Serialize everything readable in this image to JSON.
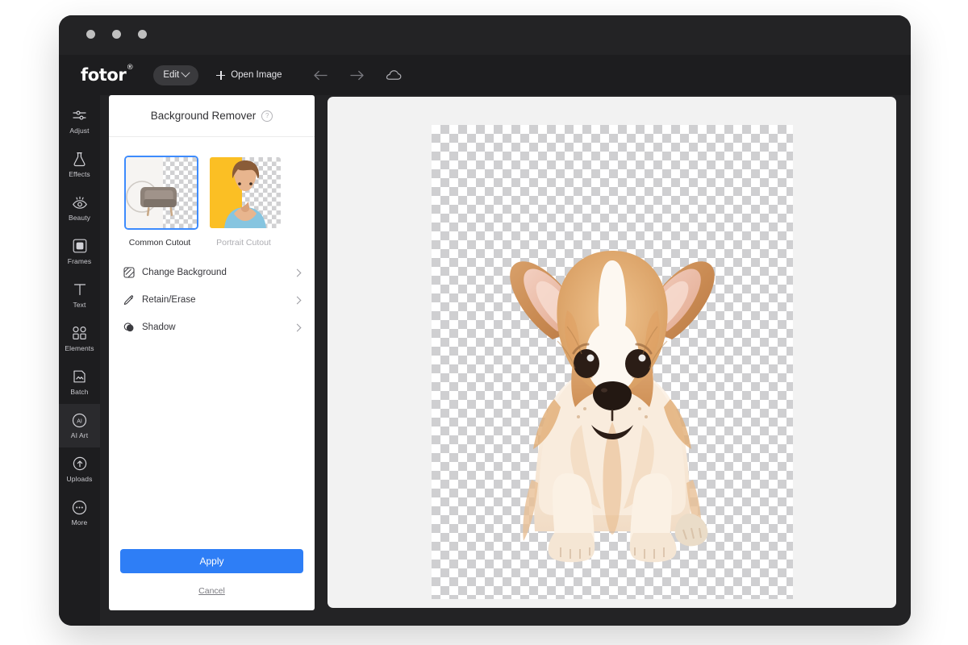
{
  "app": {
    "name": "Fotor",
    "logo_text": "fotor",
    "logo_mark": "®"
  },
  "titlebar": {
    "dots": [
      "close-dot",
      "minimize-dot",
      "maximize-dot"
    ]
  },
  "toolbar": {
    "edit_label": "Edit",
    "edit_caret": "chevron-down-icon",
    "open_image_label": "Open Image",
    "plus_icon": "plus-icon",
    "undo_icon": "arrow-left-icon",
    "redo_icon": "arrow-right-icon",
    "cloud_icon": "cloud-icon"
  },
  "sidebar": {
    "items": [
      {
        "label": "Adjust",
        "icon": "sliders-icon",
        "active": false
      },
      {
        "label": "Effects",
        "icon": "flask-icon",
        "active": false
      },
      {
        "label": "Beauty",
        "icon": "eye-icon",
        "active": false
      },
      {
        "label": "Frames",
        "icon": "frame-icon",
        "active": false
      },
      {
        "label": "Text",
        "icon": "text-t-icon",
        "active": false
      },
      {
        "label": "Elements",
        "icon": "shapes-icon",
        "active": false
      },
      {
        "label": "Batch",
        "icon": "batch-icon",
        "active": false
      },
      {
        "label": "AI Art",
        "icon": "ai-badge-icon",
        "active": true
      },
      {
        "label": "Uploads",
        "icon": "upload-cloud-icon",
        "active": false
      },
      {
        "label": "More",
        "icon": "ellipsis-icon",
        "active": false
      }
    ]
  },
  "panel": {
    "title": "Background Remover",
    "help_icon": "question-mark-icon",
    "help_glyph": "?",
    "cutouts": [
      {
        "label": "Common Cutout",
        "selected": true,
        "thumb": "armchair-thumbnail"
      },
      {
        "label": "Portrait Cutout",
        "selected": false,
        "thumb": "portrait-woman-thumbnail"
      }
    ],
    "menu": [
      {
        "label": "Change Background",
        "icon": "swatch-diagonal-icon",
        "chevron": "chevron-right-icon"
      },
      {
        "label": "Retain/Erase",
        "icon": "pen-eraser-icon",
        "chevron": "chevron-right-icon"
      },
      {
        "label": "Shadow",
        "icon": "shadow-circle-icon",
        "chevron": "chevron-right-icon"
      }
    ],
    "apply_label": "Apply",
    "cancel_label": "Cancel"
  },
  "canvas": {
    "artwork": "corgi-puppy-cutout",
    "background": "transparent-checkerboard"
  },
  "colors": {
    "accent": "#2e7ef6",
    "window_chrome": "#232325",
    "toolbar": "#1d1d1f",
    "canvas_bg": "#f2f2f2",
    "panel_bg": "#ffffff",
    "selected_border": "#3d8bfd"
  }
}
